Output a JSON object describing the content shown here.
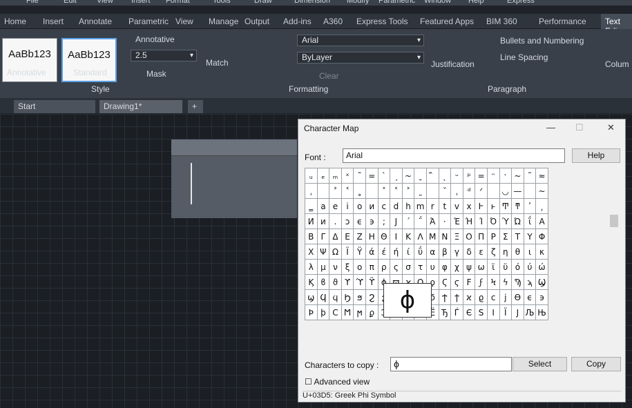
{
  "menubar": [
    "File",
    "Edit",
    "View",
    "Insert",
    "Format",
    "Tools",
    "Draw",
    "Dimension",
    "Modify",
    "Parametric",
    "Window",
    "Help",
    "Express"
  ],
  "ribbon_tabs": [
    "Home",
    "Insert",
    "Annotate",
    "Parametric",
    "View",
    "Manage",
    "Output",
    "Add-ins",
    "A360",
    "Express Tools",
    "Featured Apps",
    "BIM 360",
    "Performance",
    "Text Edi"
  ],
  "style_panel": {
    "swatch1": "AaBb123",
    "swatch1_label": "Annotative",
    "swatch2": "AaBb123",
    "swatch2_label": "Standard",
    "annotative": "Annotative",
    "height": "2.5",
    "mask": "Mask",
    "title": "Style"
  },
  "formatting_panel": {
    "match": "Match",
    "font": "Arial",
    "color": "ByLayer",
    "clear": "Clear",
    "title": "Formatting"
  },
  "paragraph_panel": {
    "justification": "Justification",
    "bullets": "Bullets and Numbering",
    "spacing": "Line Spacing",
    "title": "Paragraph"
  },
  "columns_label": "Colum",
  "doc_tabs": [
    "Start",
    "Drawing1*"
  ],
  "charmap": {
    "title": "Character Map",
    "font_label": "Font :",
    "font_value": "Arial",
    "help": "Help",
    "zoom_char": "ϕ",
    "copy_label": "Characters to copy :",
    "copy_value": "ϕ",
    "select": "Select",
    "copy": "Copy",
    "advanced": "Advanced view",
    "status": "U+03D5: Greek Phi Symbol",
    "rows": [
      [
        "ᵤ",
        "ₑ",
        "ₘ",
        "ˣ",
        "˜",
        "=",
        "ˋ",
        "ˏ",
        "~",
        "ˍ",
        "᷈",
        "ˎ",
        "ᵕ",
        "ᵖ",
        "=",
        "ᵔ",
        "ˑ",
        "~",
        "˜",
        "≈",
        "‗"
      ],
      [
        "ˌ",
        "",
        "˃",
        "˂",
        "˳",
        "",
        "˟",
        "˂",
        "˃",
        "˷",
        "",
        "ˇ",
        "ˌ",
        "ᵈ",
        "ᐟ",
        "",
        "◡",
        "—",
        "",
        "~",
        "⁀"
      ],
      [
        "‗",
        "а",
        "е",
        "і",
        "о",
        "и",
        "с",
        "d",
        "h",
        "m",
        "r",
        "t",
        "v",
        "x",
        "Ͱ",
        "ͱ",
        "Ͳ",
        "ͳ",
        "ʹ",
        "͵",
        ""
      ],
      [
        "И",
        "и",
        ".",
        "ͻ",
        "ϵ",
        "϶",
        ";",
        "Ϳ",
        "΄",
        "΅",
        "Ά",
        "·",
        "Έ",
        "Ή",
        "Ί",
        "Ό",
        "Ύ",
        "Ώ",
        "ΐ",
        "Α",
        ""
      ],
      [
        "Β",
        "Γ",
        "Δ",
        "Ε",
        "Ζ",
        "Η",
        "Θ",
        "Ι",
        "Κ",
        "Λ",
        "Μ",
        "Ν",
        "Ξ",
        "Ο",
        "Π",
        "Ρ",
        "Σ",
        "Τ",
        "Υ",
        "Φ",
        ""
      ],
      [
        "Χ",
        "Ψ",
        "Ω",
        "Ϊ",
        "Ϋ",
        "ά",
        "έ",
        "ή",
        "ί",
        "ΰ",
        "α",
        "β",
        "γ",
        "δ",
        "ε",
        "ζ",
        "η",
        "θ",
        "ι",
        "κ",
        ""
      ],
      [
        "λ",
        "μ",
        "ν",
        "ξ",
        "ο",
        "π",
        "ρ",
        "ς",
        "σ",
        "τ",
        "υ",
        "φ",
        "χ",
        "ψ",
        "ω",
        "ϊ",
        "ϋ",
        "ό",
        "ύ",
        "ώ",
        ""
      ],
      [
        "Ϗ",
        "ϐ",
        "ϑ",
        "ϒ",
        "ϓ",
        "ϔ",
        "ϕ",
        "ϖ",
        "ϗ",
        "Ϙ",
        "ϙ",
        "Ϛ",
        "ϛ",
        "Ϝ",
        "ϝ",
        "Ϟ",
        "ϟ",
        "Ϡ",
        "ϡ",
        "Ϣ",
        ""
      ],
      [
        "ϣ",
        "Ϥ",
        "ϥ",
        "Ϧ",
        "ϧ",
        "Ϩ",
        "ϩ",
        "Ϫ",
        "ϫ",
        "Ϭ",
        "ϭ",
        "Ϯ",
        "ϯ",
        "ϰ",
        "ϱ",
        "ϲ",
        "ϳ",
        "ϴ",
        "ϵ",
        "϶",
        ""
      ],
      [
        "Ϸ",
        "ϸ",
        "Ϲ",
        "Ϻ",
        "ϻ",
        "ϼ",
        "Ͻ",
        "Ͼ",
        "Ͽ",
        "Ѐ",
        "Ё",
        "Ђ",
        "Ѓ",
        "Є",
        "Ѕ",
        "І",
        "Ї",
        "Ј",
        "Љ",
        "Њ",
        ""
      ]
    ]
  }
}
